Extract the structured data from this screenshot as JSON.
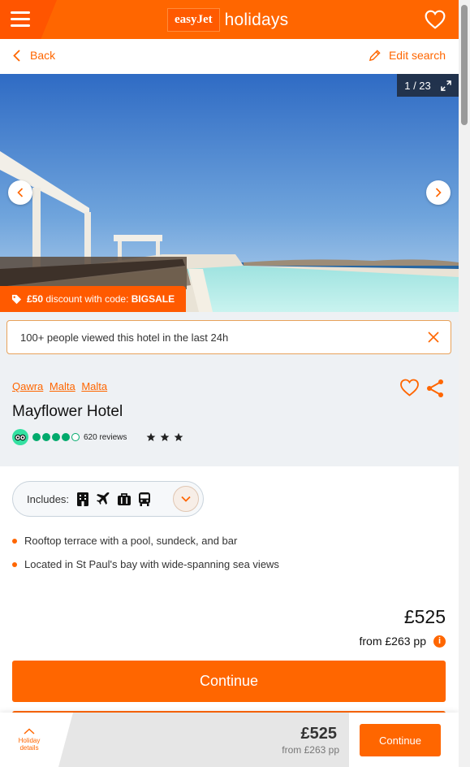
{
  "colors": {
    "brand": "#ff6600",
    "brand_dark": "#ff5500",
    "tripadvisor": "#00aa6c"
  },
  "header": {
    "logo_brand": "easyJet",
    "logo_sub": "holidays",
    "menu_icon": "hamburger-menu-icon",
    "favourite_icon": "heart-outline-icon"
  },
  "subnav": {
    "back_label": "Back",
    "edit_label": "Edit search"
  },
  "gallery": {
    "counter": "1 / 23",
    "promo_amount": "£50",
    "promo_text": " discount with code: ",
    "promo_code": "BIGSALE"
  },
  "notice": {
    "text": "100+ people viewed this hotel in the last 24h"
  },
  "hotel": {
    "breadcrumbs": [
      "Qawra",
      "Malta",
      "Malta"
    ],
    "name": "Mayflower Hotel",
    "tripadvisor_rating": 4,
    "reviews": "620 reviews",
    "stars": 3
  },
  "includes": {
    "label": "Includes:",
    "icons": [
      "hotel-icon",
      "plane-icon",
      "luggage-icon",
      "transfer-bus-icon"
    ]
  },
  "features": [
    "Rooftop terrace with a pool, sundeck, and bar",
    "Located in St Paul's bay with wide-spanning sea views"
  ],
  "price": {
    "total": "£525",
    "per_person": "from £263 pp",
    "info_icon": "i"
  },
  "cta": {
    "continue_label": "Continue"
  },
  "bottom_bar": {
    "details_label_1": "Holiday",
    "details_label_2": "details",
    "price": "£525",
    "per_person": "from £263 pp",
    "continue_label": "Continue"
  }
}
